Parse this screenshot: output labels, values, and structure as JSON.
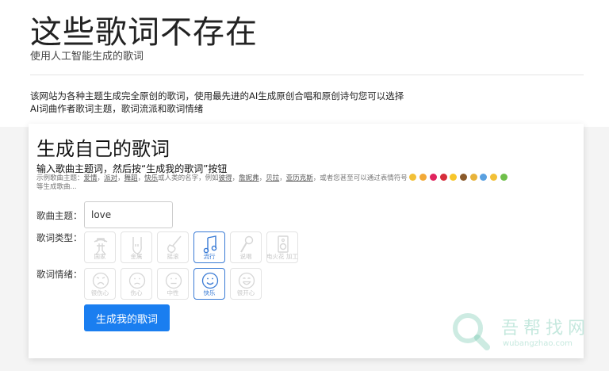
{
  "site": {
    "title": "这些歌词不存在",
    "subtitle": "使用人工智能生成的歌词"
  },
  "intro": {
    "line1": "该网站为各种主题生成完全原创的歌词，使用最先进的AI生成原创合唱和原创诗句您可以选择",
    "line2": "AI词曲作者歌词主题，歌词流派和歌词情绪"
  },
  "card": {
    "title": "生成自己的歌词",
    "instruction": "输入歌曲主题词，然后按“生成我的歌词”按钮",
    "examples_prefix": "示例歌曲主题：",
    "examples": [
      "爱情",
      "派对",
      "舞蹈",
      "快乐"
    ],
    "examples_mid": "或人类的名字，例如",
    "names": [
      "彼得",
      "詹妮弗",
      "贝拉",
      "亚历克斯"
    ],
    "examples_suffix": "，或者您甚至可以通过表情符号",
    "examples_end": "等生成歌曲..."
  },
  "form": {
    "topic_label": "歌曲主题：",
    "topic_value": "love",
    "genre_label": "歌词类型：",
    "mood_label": "歌词情绪：",
    "genres": [
      {
        "label": "国家",
        "icon": "cowboy-icon",
        "selected": false
      },
      {
        "label": "金属",
        "icon": "rock-hand-icon",
        "selected": false
      },
      {
        "label": "摇滚",
        "icon": "guitar-icon",
        "selected": false
      },
      {
        "label": "流行",
        "icon": "music-note-icon",
        "selected": true
      },
      {
        "label": "说唱",
        "icon": "microphone-icon",
        "selected": false
      },
      {
        "label": "电火花 加工",
        "icon": "speaker-icon",
        "selected": false
      }
    ],
    "moods": [
      {
        "label": "很伤心",
        "icon": "very-sad-face-icon",
        "selected": false
      },
      {
        "label": "伤心",
        "icon": "sad-face-icon",
        "selected": false
      },
      {
        "label": "中性",
        "icon": "neutral-face-icon",
        "selected": false
      },
      {
        "label": "快乐",
        "icon": "happy-face-icon",
        "selected": true
      },
      {
        "label": "很开心",
        "icon": "very-happy-face-icon",
        "selected": false
      }
    ],
    "generate_button": "生成我的歌词"
  },
  "watermark": {
    "text": "吾帮找网",
    "url": "wubangzhao.com"
  },
  "colors": {
    "accent": "#1a7ef0",
    "selected_border": "#3a7bd5"
  }
}
